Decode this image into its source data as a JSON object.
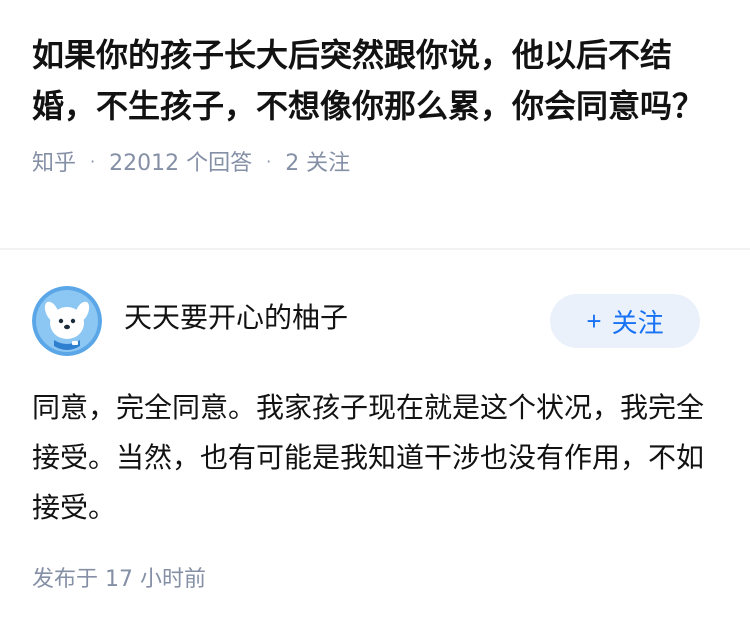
{
  "question": {
    "title": "如果你的孩子长大后突然跟你说，他以后不结婚，不生孩子，不想像你那么累，你会同意吗？",
    "source": "知乎",
    "separator": "·",
    "answer_count": "22012 个回答",
    "follow_count": "2 关注"
  },
  "author": {
    "avatar_icon": "cartoon-dog-avatar-icon",
    "name": "天天要开心的柚子",
    "follow_plus": "+",
    "follow_label": "关注"
  },
  "answer": {
    "content": "同意，完全同意。我家孩子现在就是这个状况，我完全接受。当然，也有可能是我知道干涉也没有作用，不如接受。",
    "publish_time": "发布于 17 小时前"
  },
  "colors": {
    "text_primary": "#121212",
    "text_secondary": "#8590a6",
    "accent_blue": "#1772f6",
    "follow_bg": "#ebf1fa",
    "avatar_bg": "#5aa6e6"
  }
}
